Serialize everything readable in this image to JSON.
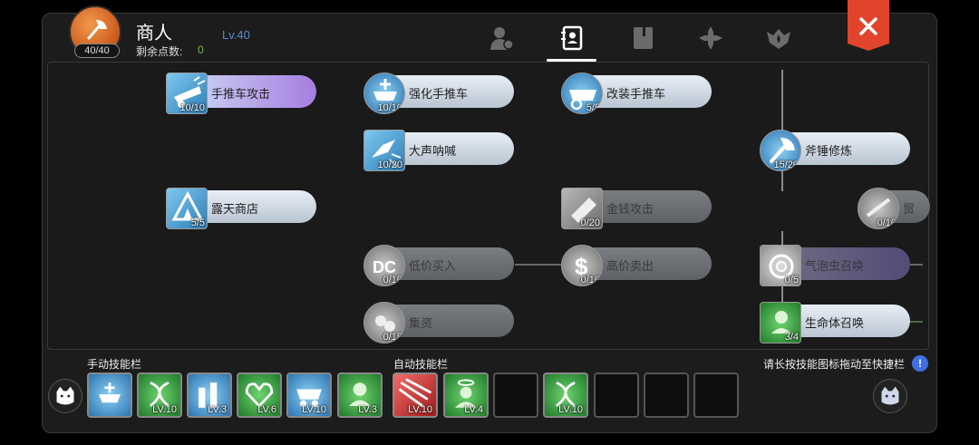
{
  "header": {
    "avatar_count": "40/40",
    "class_name": "商人",
    "level": "Lv.40",
    "points_label": "剩余点数:",
    "points_value": "0",
    "tabs": [
      "profile-tab",
      "skill-book-tab",
      "guide-book-tab",
      "cross-tab",
      "emblem-tab"
    ],
    "active_tab": "skill-book-tab"
  },
  "skills": [
    {
      "name": "手推车攻击",
      "count": "10/10",
      "icon": "cart-attack-icon",
      "style": "purple"
    },
    {
      "name": "强化手推车",
      "count": "10/10",
      "icon": "cart-boost-icon",
      "style": "light"
    },
    {
      "name": "改装手推车",
      "count": "5/5",
      "icon": "cart-modify-icon",
      "style": "light"
    },
    {
      "name": "大声呐喊",
      "count": "10/20",
      "icon": "loud-shout-icon",
      "style": "light"
    },
    {
      "name": "斧锤修炼",
      "count": "15/20",
      "icon": "axe-hammer-training-icon",
      "style": "light"
    },
    {
      "name": "露天商店",
      "count": "5/5",
      "icon": "open-shop-icon",
      "style": "light"
    },
    {
      "name": "金钱攻击",
      "count": "0/20",
      "icon": "money-attack-icon",
      "style": "grey"
    },
    {
      "name": "贸",
      "count": "0/10",
      "icon": "trade-icon",
      "style": "grey"
    },
    {
      "name": "低价买入",
      "count": "0/10",
      "icon": "discount-icon",
      "style": "grey"
    },
    {
      "name": "高价卖出",
      "count": "0/10",
      "icon": "overcharge-icon",
      "style": "grey"
    },
    {
      "name": "气泡虫召唤",
      "count": "0/5",
      "icon": "bubble-bug-summon-icon",
      "style": "violet"
    },
    {
      "name": "集资",
      "count": "0/15",
      "icon": "fundraise-icon",
      "style": "grey"
    },
    {
      "name": "生命体召唤",
      "count": "3/4",
      "icon": "life-form-summon-icon",
      "style": "light"
    }
  ],
  "manual_bar": {
    "label": "手动技能栏",
    "slots": [
      {
        "icon": "cart-boost-slot-icon",
        "lv": ""
      },
      {
        "icon": "dna-slot-icon",
        "lv": "LV.10"
      },
      {
        "icon": "potion-slot-icon",
        "lv": "LV.3"
      },
      {
        "icon": "heart-slot-icon",
        "lv": "LV.6"
      },
      {
        "icon": "cart-mod-slot-icon",
        "lv": "LV.10"
      },
      {
        "icon": "life-form-slot-icon",
        "lv": "LV.3"
      }
    ]
  },
  "auto_bar": {
    "label": "自动技能栏",
    "slots": [
      {
        "icon": "red-strike-slot-icon",
        "lv": "LV.10"
      },
      {
        "icon": "angel-slot-icon",
        "lv": "LV.4"
      },
      {
        "icon": "empty",
        "lv": ""
      },
      {
        "icon": "dna-slot-icon",
        "lv": "LV.10"
      },
      {
        "icon": "empty",
        "lv": ""
      },
      {
        "icon": "empty",
        "lv": ""
      },
      {
        "icon": "empty",
        "lv": ""
      }
    ]
  },
  "hint": {
    "text": "请长按技能图标拖动至快捷栏",
    "icon_text": "!"
  },
  "colors": {
    "accent_orange": "#e2582a",
    "close_red": "#e0452b",
    "link_blue": "#5a8ad0",
    "points_green": "#7ab84a"
  }
}
